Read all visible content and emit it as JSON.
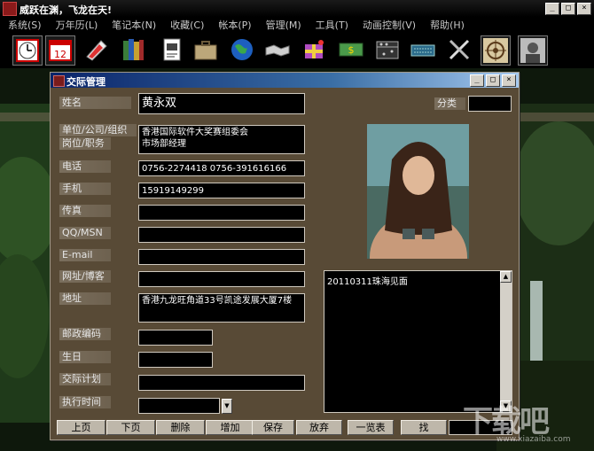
{
  "titlebar": {
    "title": "威跃在渊，飞龙在天!"
  },
  "window_buttons": {
    "minimize": "_",
    "maximize": "□",
    "close": "×"
  },
  "menu": [
    "系统(S)",
    "万年历(L)",
    "笔记本(N)",
    "收藏(C)",
    "帐本(P)",
    "管理(M)",
    "工具(T)",
    "动画控制(V)",
    "帮助(H)"
  ],
  "toolbar": [
    {
      "name": "clock-icon"
    },
    {
      "name": "calendar-icon"
    },
    {
      "name": "notebook-icon"
    },
    {
      "name": "books-icon"
    },
    {
      "name": "document-icon"
    },
    {
      "name": "briefcase-icon"
    },
    {
      "name": "globe-icon"
    },
    {
      "name": "handshake-icon"
    },
    {
      "name": "gift-box-icon"
    },
    {
      "name": "money-icon"
    },
    {
      "name": "abacus-icon"
    },
    {
      "name": "keyboard-icon"
    },
    {
      "name": "tools-icon"
    },
    {
      "name": "helm-icon"
    },
    {
      "name": "portrait-icon"
    }
  ],
  "dialog": {
    "title": "交际管理",
    "labels": {
      "name": "姓名",
      "category": "分类",
      "company": "单位/公司/组织",
      "position": "岗位/职务",
      "phone": "电话",
      "mobile": "手机",
      "fax": "传真",
      "qq": "QQ/MSN",
      "email": "E-mail",
      "website": "网址/博客",
      "address": "地址",
      "postcode": "邮政编码",
      "birthday": "生日",
      "plan": "交际计划",
      "exec_time": "执行时间"
    },
    "values": {
      "name": "黄永双",
      "category": "",
      "company_line1": "香港国际软件大奖赛组委会",
      "company_line2": "市场部经理",
      "phone": "0756-2274418 0756-391616166",
      "mobile": "15919149299",
      "fax": "",
      "qq": "",
      "email": "",
      "website": "",
      "address": "香港九龙旺角道33号凯途发展大厦7楼",
      "postcode": "",
      "birthday": "",
      "plan": "",
      "exec_time": ""
    },
    "notes": "20110311珠海见面",
    "buttons": [
      "上页",
      "下页",
      "删除",
      "增加",
      "保存",
      "放弃",
      "一览表",
      "找"
    ]
  },
  "watermark": {
    "text": "下载吧",
    "url": "www.xiazaiba.com"
  },
  "colors": {
    "dialog_bg": "#584a36",
    "title_gradient_start": "#0a246a",
    "field_bg": "#000000"
  }
}
